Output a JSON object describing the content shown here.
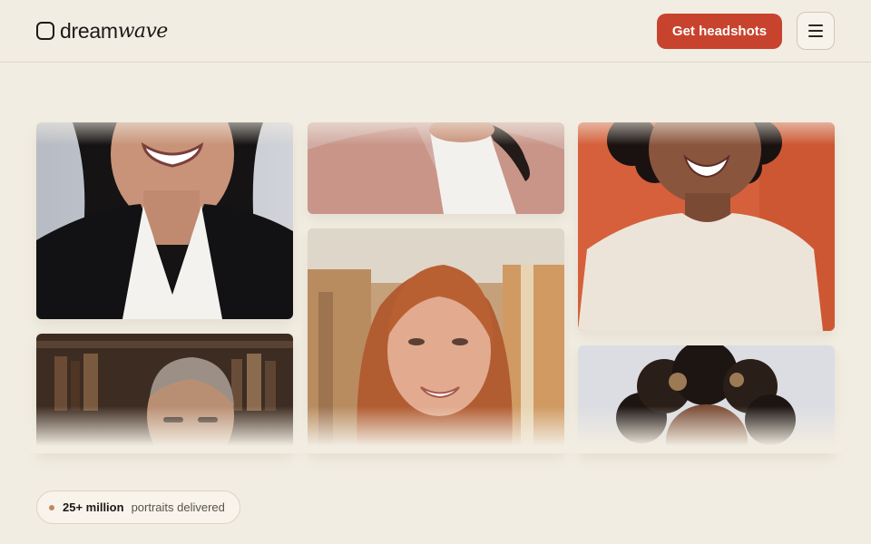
{
  "header": {
    "logo": {
      "part1": "dream",
      "part2": "wave"
    },
    "cta_label": "Get headshots",
    "menu_icon": "hamburger-menu-icon"
  },
  "gallery": {
    "photos": [
      {
        "id": "woman-black-blazer",
        "bg": "#c9ccd3"
      },
      {
        "id": "woman-pink-blazer",
        "bg": "#cfa7a0"
      },
      {
        "id": "woman-orange-backdrop",
        "bg": "#d55e3a"
      },
      {
        "id": "man-bookshelf",
        "bg": "#3b2c22"
      },
      {
        "id": "redhead-woman-office",
        "bg": "#c9a274"
      },
      {
        "id": "woman-curly-hair",
        "bg": "#dcdde2"
      }
    ]
  },
  "stat": {
    "value": "25+ million",
    "label": "portraits delivered",
    "dot_color": "#c0895f"
  },
  "colors": {
    "background": "#f2ede2",
    "accent": "#c8432e"
  }
}
